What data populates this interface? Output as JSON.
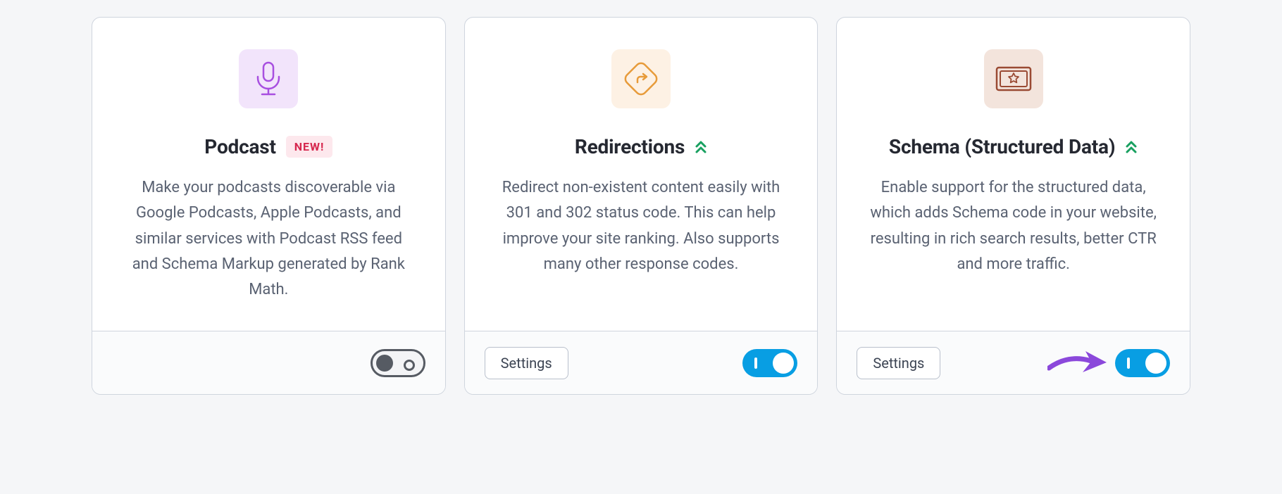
{
  "cards": [
    {
      "id": "podcast",
      "title": "Podcast",
      "badge": "NEW!",
      "has_badge": true,
      "has_chevron": false,
      "description": "Make your podcasts discoverable via Google Podcasts, Apple Podcasts, and similar services with Podcast RSS feed and Schema Markup generated by Rank Math.",
      "has_settings": false,
      "toggle_on": false,
      "icon": "microphone-icon",
      "icon_bg": "purple"
    },
    {
      "id": "redirections",
      "title": "Redirections",
      "has_badge": false,
      "has_chevron": true,
      "description": "Redirect non-existent content easily with 301 and 302 status code. This can help improve your site ranking. Also supports many other response codes.",
      "has_settings": true,
      "settings_label": "Settings",
      "toggle_on": true,
      "icon": "redirect-icon",
      "icon_bg": "orange"
    },
    {
      "id": "schema",
      "title": "Schema (Structured Data)",
      "has_badge": false,
      "has_chevron": true,
      "description": "Enable support for the structured data, which adds Schema code in your website, resulting in rich search results, better CTR and more traffic.",
      "has_settings": true,
      "settings_label": "Settings",
      "toggle_on": true,
      "icon": "schema-icon",
      "icon_bg": "brown",
      "has_arrow_annotation": true
    }
  ]
}
